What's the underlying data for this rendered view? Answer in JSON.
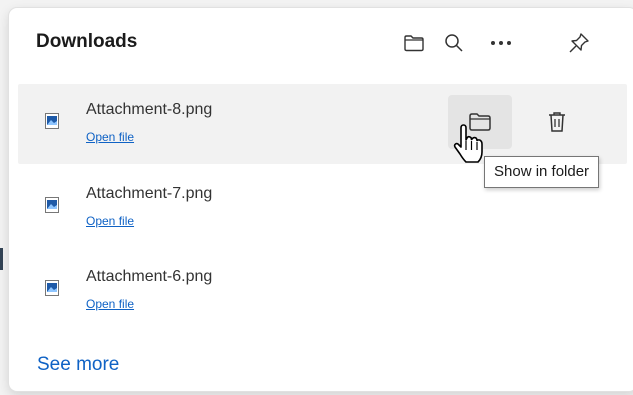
{
  "panel": {
    "title": "Downloads",
    "header_icons": [
      "folder-icon",
      "search-icon",
      "more-icon",
      "pin-icon"
    ]
  },
  "items": [
    {
      "file_name": "Attachment-8.png",
      "link": "Open file"
    },
    {
      "file_name": "Attachment-7.png",
      "link": "Open file"
    },
    {
      "file_name": "Attachment-6.png",
      "link": "Open file"
    }
  ],
  "row_actions": {
    "folder_icon": "folder-icon",
    "trash_icon": "trash-icon"
  },
  "tooltip": "Show in folder",
  "see_more": "See more",
  "colors": {
    "link": "#0f62c5",
    "hover_row": "#f2f2f2",
    "hover_button": "#e4e4e4"
  }
}
